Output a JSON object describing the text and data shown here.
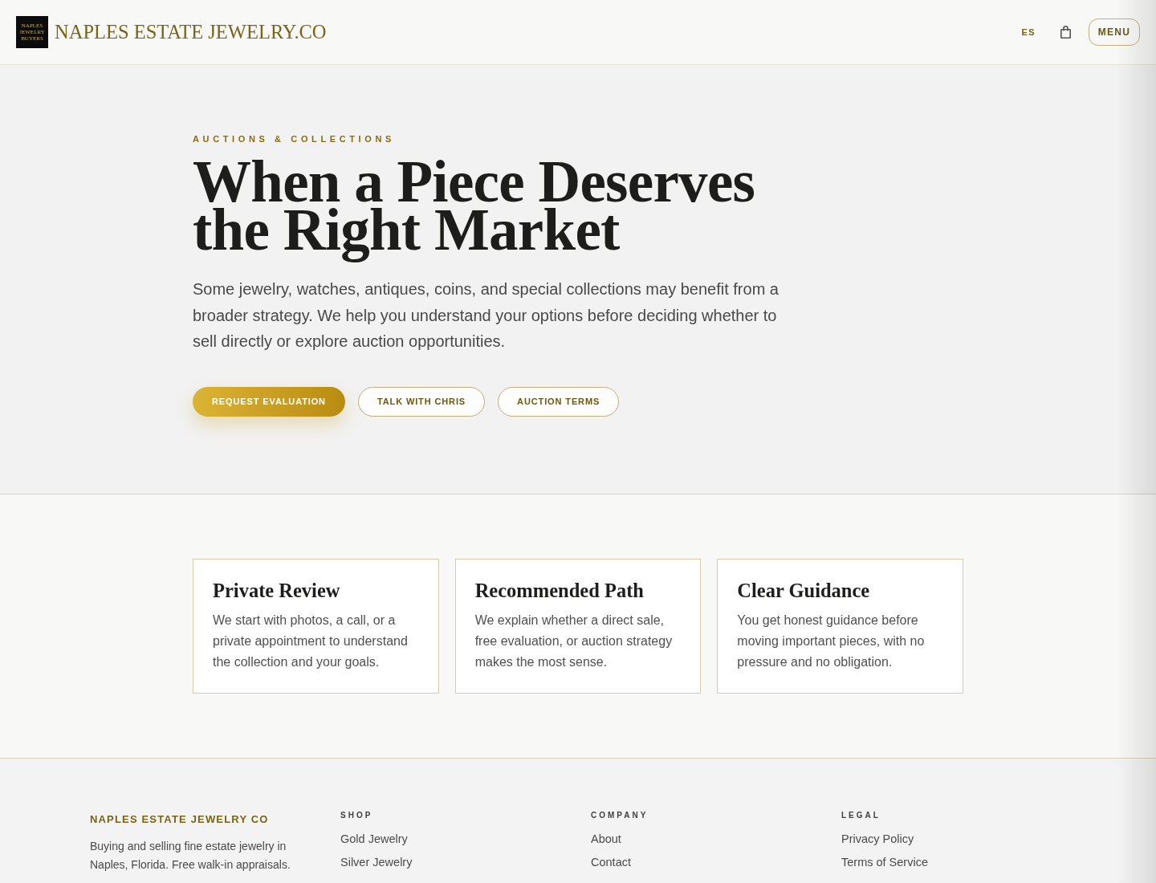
{
  "header": {
    "logo": {
      "lines": [
        "NAPLES",
        "JEWELRY",
        "BUYERS"
      ]
    },
    "site_name": "NAPLES ESTATE JEWELRY.CO",
    "language_link": "ES",
    "menu_button": "MENU"
  },
  "hero": {
    "eyebrow": "AUCTIONS & COLLECTIONS",
    "heading": "When a Piece Deserves the Right Market",
    "body": "Some jewelry, watches, antiques, coins, and special collections may benefit from a broader strategy. We help you understand your options before deciding whether to sell directly or explore auction opportunities.",
    "buttons": [
      {
        "label": "REQUEST EVALUATION",
        "kind": "primary"
      },
      {
        "label": "TALK WITH CHRIS",
        "kind": "outline"
      },
      {
        "label": "AUCTION TERMS",
        "kind": "outline"
      }
    ]
  },
  "features": [
    {
      "title": "Private Review",
      "body": "We start with photos, a call, or a private appointment to understand the collection and your goals."
    },
    {
      "title": "Recommended Path",
      "body": "We explain whether a direct sale, free evaluation, or auction strategy makes the most sense."
    },
    {
      "title": "Clear Guidance",
      "body": "You get honest guidance before moving important pieces, with no pressure and no obligation."
    }
  ],
  "footer": {
    "brand": {
      "name": "NAPLES ESTATE JEWELRY CO",
      "description": "Buying and selling fine estate jewelry in Naples, Florida. Free walk-in appraisals."
    },
    "columns": [
      {
        "title": "SHOP",
        "links": [
          "Gold Jewelry",
          "Silver Jewelry"
        ]
      },
      {
        "title": "COMPANY",
        "links": [
          "About",
          "Contact"
        ]
      },
      {
        "title": "LEGAL",
        "links": [
          "Privacy Policy",
          "Terms of Service"
        ]
      }
    ]
  }
}
